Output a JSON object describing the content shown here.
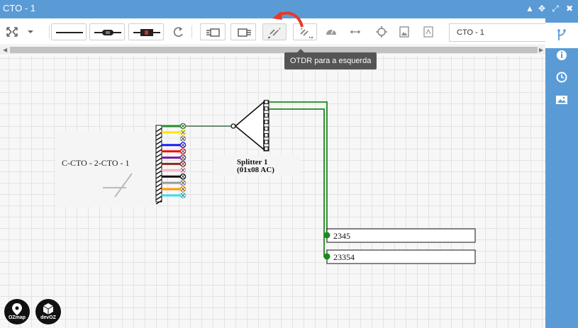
{
  "window": {
    "title": "CTO - 1"
  },
  "toolbar": {
    "name_value": "CTO - 1",
    "buttons": [
      {
        "name": "expand-dropdown-button",
        "icon": "expand-arrows-icon"
      },
      {
        "name": "cable-line-button",
        "icon": "cable-line-icon"
      },
      {
        "name": "fusion-button",
        "icon": "fusion-splice-icon"
      },
      {
        "name": "connector-button",
        "icon": "connector-icon"
      },
      {
        "name": "refresh-button",
        "icon": "refresh-icon"
      },
      {
        "name": "plug-button",
        "icon": "plug-icon"
      },
      {
        "name": "splitter-button",
        "icon": "splitter-icon"
      },
      {
        "name": "otdr-left-button",
        "icon": "otdr-left-icon"
      },
      {
        "name": "otdr-right-button",
        "icon": "otdr-right-icon"
      },
      {
        "name": "gauge-button",
        "icon": "gauge-icon"
      },
      {
        "name": "horizontal-arrows-button",
        "icon": "arrows-h-icon"
      },
      {
        "name": "crosshair-button",
        "icon": "crosshair-icon"
      },
      {
        "name": "image-export-button",
        "icon": "image-icon"
      },
      {
        "name": "pdf-export-button",
        "icon": "pdf-icon"
      }
    ]
  },
  "tooltip": {
    "text": "OTDR para a esquerda"
  },
  "diagram": {
    "cable_label": "C-CTO - 2-CTO - 1",
    "splitter_name": "Splitter 1",
    "splitter_type": "(01x08 AC)",
    "fiber_colors": [
      "#2e8b2e",
      "#ffe600",
      "#f2f2f2",
      "#1a1aff",
      "#ee1111",
      "#7a1fa2",
      "#8b2b1a",
      "#f2b6c8",
      "#111111",
      "#9a9a9a",
      "#ff9900",
      "#35e0f0"
    ],
    "clients": [
      {
        "label": "2345"
      },
      {
        "label": "23354"
      }
    ],
    "link_color": "#1b8a1b"
  },
  "side_panel": {
    "icons": [
      "routing-icon",
      "info-icon",
      "history-icon",
      "picture-icon"
    ]
  },
  "logos": {
    "ozmap_label": "OZmap",
    "devoz_label": "devOZ"
  }
}
